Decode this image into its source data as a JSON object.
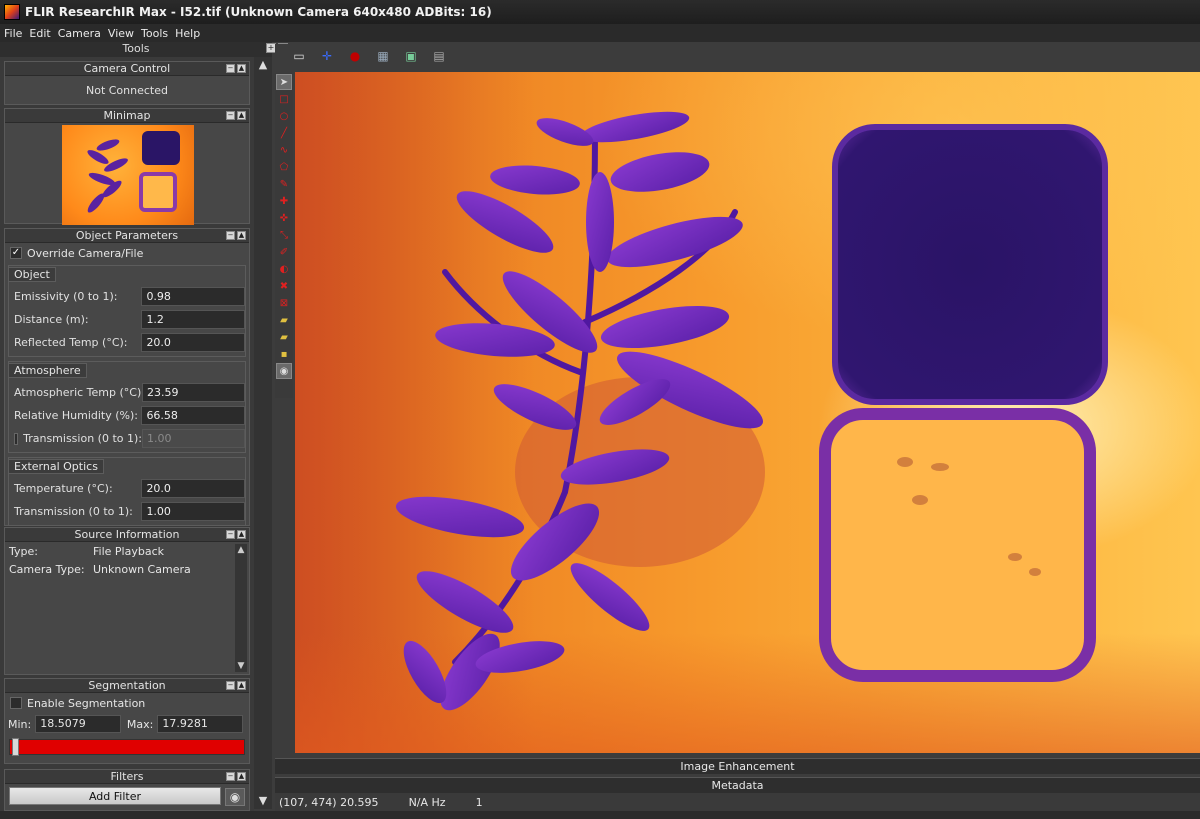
{
  "window": {
    "title": "FLIR ResearchIR Max - I52.tif (Unknown Camera 640x480 ADBits: 16)"
  },
  "menu": [
    "File",
    "Edit",
    "Camera",
    "View",
    "Tools",
    "Help"
  ],
  "tools_header": "Tools",
  "camera_control": {
    "title": "Camera Control",
    "status": "Not Connected"
  },
  "minimap": {
    "title": "Minimap"
  },
  "object_params": {
    "title": "Object Parameters",
    "override_label": "Override Camera/File",
    "override_checked": true,
    "object_group": "Object",
    "emissivity_label": "Emissivity (0 to 1):",
    "emissivity": "0.98",
    "distance_label": "Distance (m):",
    "distance": "1.2",
    "reflected_label": "Reflected Temp (°C):",
    "reflected": "20.0",
    "atmosphere_group": "Atmosphere",
    "atm_temp_label": "Atmospheric Temp (°C):",
    "atm_temp": "23.59",
    "humidity_label": "Relative Humidity (%):",
    "humidity": "66.58",
    "transmission_label": "Transmission (0 to 1):",
    "transmission": "1.00",
    "optics_group": "External Optics",
    "ext_temp_label": "Temperature (°C):",
    "ext_temp": "20.0",
    "ext_trans_label": "Transmission (0 to 1):",
    "ext_trans": "1.00"
  },
  "source_info": {
    "title": "Source Information",
    "type_label": "Type:",
    "type": "File Playback",
    "camera_label": "Camera Type:",
    "camera": "Unknown Camera"
  },
  "segmentation": {
    "title": "Segmentation",
    "enable_label": "Enable Segmentation",
    "min_label": "Min:",
    "min": "18.5079",
    "max_label": "Max:",
    "max": "17.9281"
  },
  "filters": {
    "title": "Filters",
    "add_label": "Add Filter"
  },
  "bottom": {
    "image_enhancement": "Image Enhancement",
    "metadata": "Metadata"
  },
  "status": {
    "coords": "(107, 474) 20.595",
    "rate": "N/A Hz",
    "frame": "1"
  },
  "colors": {
    "accent_red": "#e00000",
    "background": "#3c3c3c"
  }
}
